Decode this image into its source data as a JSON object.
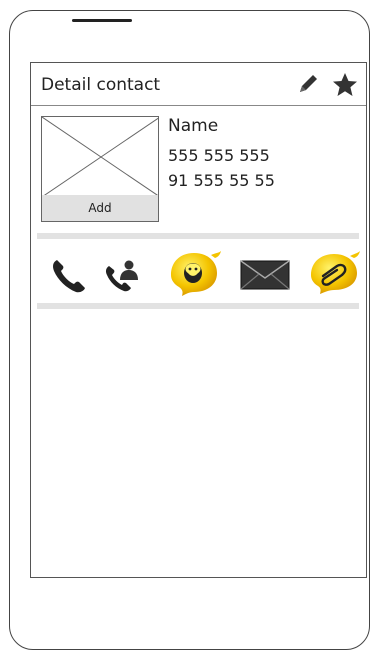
{
  "header": {
    "title": "Detail contact",
    "edit_icon": "pencil-icon",
    "favorite_icon": "star-icon"
  },
  "contact": {
    "photo_add_label": "Add",
    "name": "Name",
    "phones": [
      "555 555 555",
      "91 555 55 55"
    ]
  },
  "actions": [
    {
      "icon": "phone-icon"
    },
    {
      "icon": "contact-call-icon"
    },
    {
      "icon": "chat-icon"
    },
    {
      "icon": "mail-icon"
    },
    {
      "icon": "attachment-icon"
    }
  ],
  "colors": {
    "accent_yellow": "#f4c400",
    "divider": "#e2e2e2",
    "frame": "#444444"
  }
}
